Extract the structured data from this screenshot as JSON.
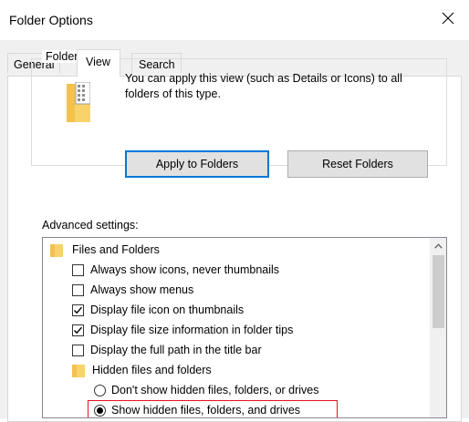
{
  "window": {
    "title": "Folder Options",
    "close_icon": "close-icon"
  },
  "tabs": [
    {
      "label": "General",
      "active": false
    },
    {
      "label": "View",
      "active": true
    },
    {
      "label": "Search",
      "active": false
    }
  ],
  "folder_views": {
    "legend": "Folder views",
    "description": "You can apply this view (such as Details or Icons) to all folders of this type.",
    "apply_button": "Apply to Folders",
    "reset_button": "Reset Folders",
    "icon": "folder-view-icon"
  },
  "advanced": {
    "label": "Advanced settings:",
    "items": [
      {
        "type": "folder",
        "label": "Files and Folders"
      },
      {
        "type": "checkbox",
        "label": "Always show icons, never thumbnails",
        "checked": false
      },
      {
        "type": "checkbox",
        "label": "Always show menus",
        "checked": false
      },
      {
        "type": "checkbox",
        "label": "Display file icon on thumbnails",
        "checked": true
      },
      {
        "type": "checkbox",
        "label": "Display file size information in folder tips",
        "checked": true
      },
      {
        "type": "checkbox",
        "label": "Display the full path in the title bar",
        "checked": false
      },
      {
        "type": "folder",
        "label": "Hidden files and folders"
      },
      {
        "type": "radio",
        "label": "Don't show hidden files, folders, or drives",
        "checked": false
      },
      {
        "type": "radio",
        "label": "Show hidden files, folders, and drives",
        "checked": true
      }
    ]
  },
  "colors": {
    "accent": "#0078d7",
    "highlight_border": "#e81123",
    "dialog_bg": "#f0f0f0"
  }
}
